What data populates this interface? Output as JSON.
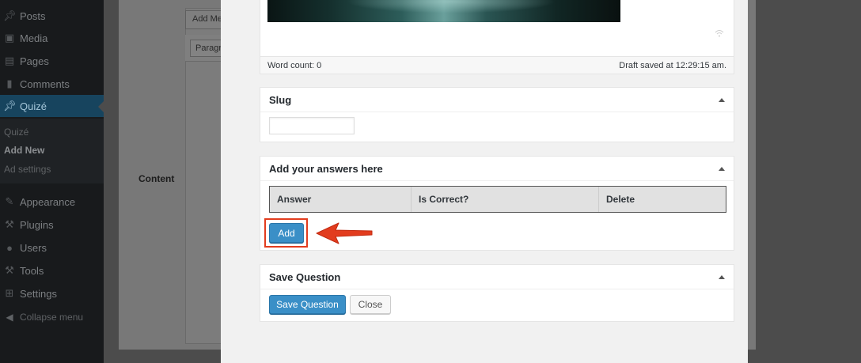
{
  "sidebar": {
    "items": [
      {
        "label": "Posts",
        "icon": "pin-icon"
      },
      {
        "label": "Media",
        "icon": "media-icon"
      },
      {
        "label": "Pages",
        "icon": "pages-icon"
      },
      {
        "label": "Comments",
        "icon": "comments-icon"
      },
      {
        "label": "Quizé",
        "icon": "pin-icon"
      }
    ],
    "submenu": [
      "Quizé",
      "Add New",
      "Ad settings"
    ],
    "lower_items": [
      {
        "label": "Appearance",
        "icon": "appearance-icon"
      },
      {
        "label": "Plugins",
        "icon": "plugins-icon"
      },
      {
        "label": "Users",
        "icon": "users-icon"
      },
      {
        "label": "Tools",
        "icon": "tools-icon"
      },
      {
        "label": "Settings",
        "icon": "settings-icon"
      }
    ],
    "collapse_label": "Collapse menu"
  },
  "background_page": {
    "content_label": "Content",
    "add_media_label": "Add Media",
    "format_select": "Paragraph"
  },
  "editor": {
    "word_count": "Word count: 0",
    "draft_status": "Draft saved at 12:29:15 am."
  },
  "slug": {
    "title": "Slug",
    "value": ""
  },
  "answers": {
    "title": "Add your answers here",
    "columns": [
      "Answer",
      "Is Correct?",
      "Delete"
    ],
    "add_label": "Add"
  },
  "save": {
    "title": "Save Question",
    "save_label": "Save Question",
    "close_label": "Close"
  },
  "colors": {
    "primary_button": "#3a8fc7",
    "annotation_red": "#e23c1e",
    "sidebar_bg": "#181a1c",
    "current_menu": "#17445e"
  }
}
